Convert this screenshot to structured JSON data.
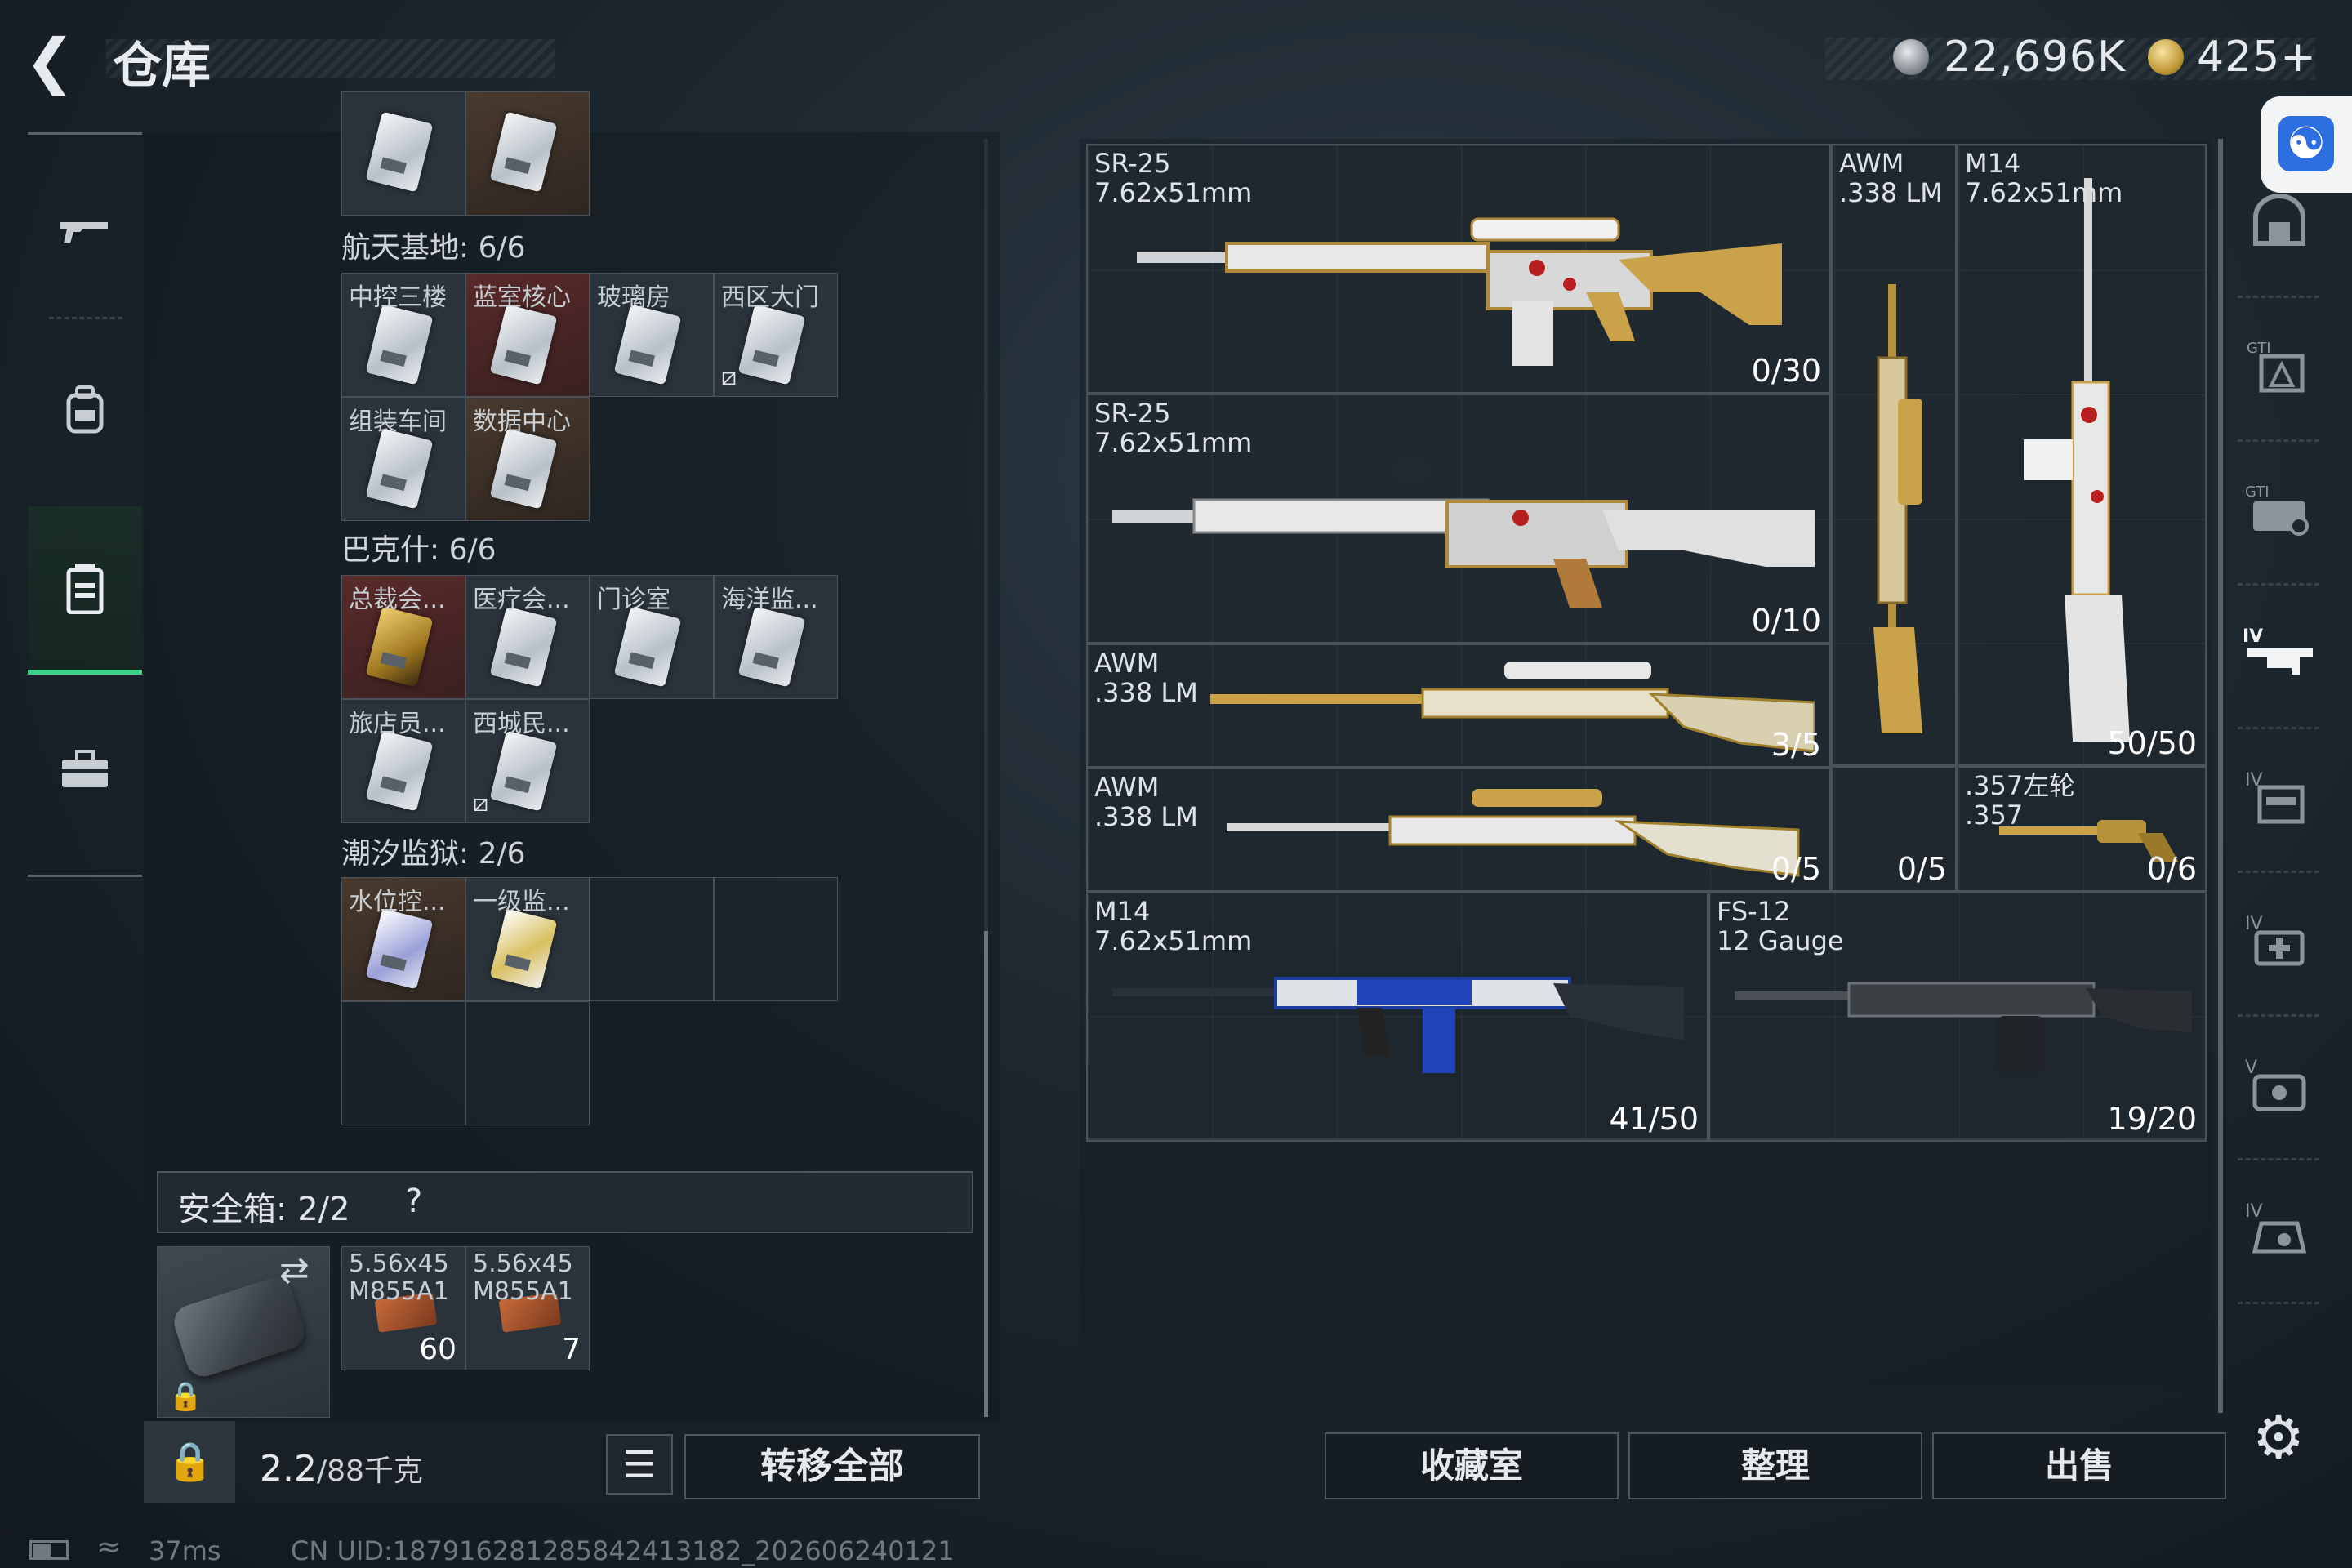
{
  "header": {
    "back_icon": "back-arrow-icon",
    "title": "仓库",
    "currency_silver": "22,696K",
    "currency_gold": "425+"
  },
  "left_nav": {
    "items": [
      {
        "name": "weapons",
        "icon": "gun-icon"
      },
      {
        "name": "equipment",
        "icon": "backpack-icon"
      },
      {
        "name": "inventory",
        "icon": "canister-icon",
        "active": true
      },
      {
        "name": "toolbox",
        "icon": "toolbox-icon"
      }
    ]
  },
  "stash": {
    "top_row": {
      "cells": 2
    },
    "sections": [
      {
        "header": "航天基地: 6/6",
        "cells": [
          {
            "label": "中控三楼",
            "bg": "plain"
          },
          {
            "label": "蓝室核心",
            "bg": "red"
          },
          {
            "label": "玻璃房",
            "bg": "plain"
          },
          {
            "label": "西区大门",
            "bg": "plain",
            "marked": true
          },
          {
            "label": "组装车间",
            "bg": "plain"
          },
          {
            "label": "数据中心",
            "bg": "brown"
          }
        ]
      },
      {
        "header": "巴克什: 6/6",
        "cells": [
          {
            "label": "总裁会...",
            "bg": "red",
            "card": "gold"
          },
          {
            "label": "医疗会...",
            "bg": "plain"
          },
          {
            "label": "门诊室",
            "bg": "plain"
          },
          {
            "label": "海洋监...",
            "bg": "plain"
          },
          {
            "label": "旅店员...",
            "bg": "plain"
          },
          {
            "label": "西城民...",
            "bg": "plain",
            "marked": true
          }
        ]
      },
      {
        "header": "潮汐监狱: 2/6",
        "cells": [
          {
            "label": "水位控...",
            "bg": "brown",
            "card": "purple"
          },
          {
            "label": "一级监...",
            "bg": "plain",
            "card": "yellow"
          }
        ]
      }
    ],
    "secure_box": {
      "label": "安全箱: 2/2",
      "help": "?",
      "items": [
        {
          "label": "5.56x45\nM855A1",
          "qty": "60"
        },
        {
          "label": "5.56x45\nM855A1",
          "qty": "7"
        }
      ]
    },
    "weight": {
      "value": "2.2",
      "unit": "/88千克",
      "icon": "kg-lock-icon"
    },
    "list_button_icon": "list-icon",
    "transfer_all": "转移全部"
  },
  "weapons": [
    {
      "name": "SR-25\n7.62x51mm",
      "count": "0/30",
      "palette": "white-gold-red"
    },
    {
      "name": "AWM\n.338 LM",
      "count": "",
      "palette": "gold"
    },
    {
      "name": "M14\n7.62x51mm",
      "count": "50/50",
      "palette": "white-red-gold"
    },
    {
      "name": "SR-25\n7.62x51mm",
      "count": "0/10",
      "palette": "white-gold-red"
    },
    {
      "name": "AWM\n.338 LM",
      "count": "3/5",
      "palette": "gold"
    },
    {
      "name": "AWM\n.338 LM",
      "count": "0/5",
      "palette": "white-gold"
    },
    {
      "name": "",
      "count": "0/5",
      "palette": ""
    },
    {
      "name": ".357左轮\n.357",
      "count": "0/6",
      "palette": "gold"
    },
    {
      "name": "M14\n7.62x51mm",
      "count": "41/50",
      "palette": "blue-white"
    },
    {
      "name": "FS-12\n12 Gauge",
      "count": "19/20",
      "palette": "dark"
    }
  ],
  "right_nav": {
    "items": [
      {
        "icon": "helmet-icon"
      },
      {
        "icon": "armor-gti-icon"
      },
      {
        "icon": "rig-gti-icon"
      },
      {
        "icon": "rifle-iv-icon",
        "active": true
      },
      {
        "icon": "backpack-iv-icon"
      },
      {
        "icon": "medkit-iv-icon"
      },
      {
        "icon": "case-v-icon"
      },
      {
        "icon": "bag-iv-icon"
      }
    ],
    "settings_icon": "gear-icon"
  },
  "bottom_buttons": {
    "collection": "收藏室",
    "sort": "整理",
    "sell": "出售"
  },
  "status": {
    "ping": "37ms",
    "uid": "CN UID:18791628128584241318​2_202606240121"
  },
  "colors": {
    "accent_green": "#3fd08a",
    "accessibility_blue": "#2d6fe0",
    "cell_red": "#5a2a2a",
    "cell_brown": "#4a3a2e"
  }
}
